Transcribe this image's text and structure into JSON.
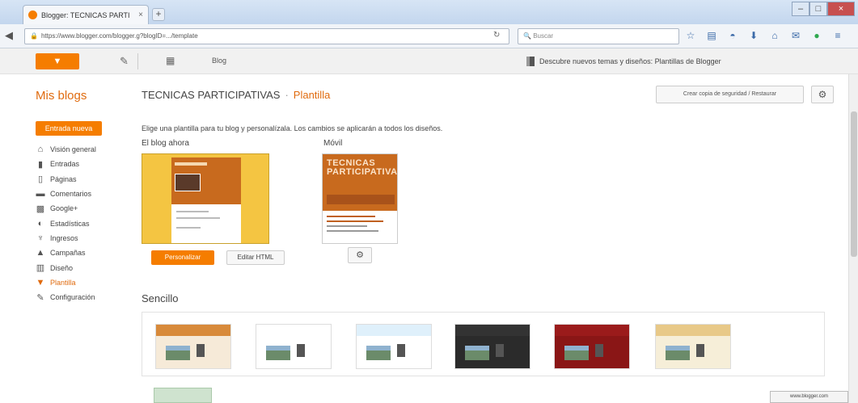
{
  "browser": {
    "tab_title": "Blogger: TECNICAS PARTI",
    "tab_close": "×",
    "new_tab": "+",
    "url": "https://www.blogger.com/blogger.g?blogID=.../template",
    "search_placeholder": "Buscar",
    "window_controls": [
      "–",
      "□",
      "×"
    ]
  },
  "blogger_bar": {
    "post_title": "Blog",
    "notice": "Descubre nuevos temas y diseños: Plantillas de Blogger"
  },
  "sidebar": {
    "title": "Mis blogs",
    "new_entry": "Entrada nueva",
    "items": [
      {
        "label": "Visión general",
        "icon": "home-icon"
      },
      {
        "label": "Entradas",
        "icon": "document-icon"
      },
      {
        "label": "Páginas",
        "icon": "page-icon"
      },
      {
        "label": "Comentarios",
        "icon": "comment-icon"
      },
      {
        "label": "Google+",
        "icon": "googleplus-icon"
      },
      {
        "label": "Estadísticas",
        "icon": "stats-icon"
      },
      {
        "label": "Ingresos",
        "icon": "trophy-icon"
      },
      {
        "label": "Campañas",
        "icon": "campaign-icon"
      },
      {
        "label": "Diseño",
        "icon": "layout-icon"
      },
      {
        "label": "Plantilla",
        "icon": "template-icon",
        "active": true
      },
      {
        "label": "Configuración",
        "icon": "wrench-icon"
      }
    ]
  },
  "main": {
    "blog_name": "TECNICAS PARTICIPATIVAS",
    "separator": "·",
    "breadcrumb": "Plantilla",
    "backup_button": "Crear copia de seguridad / Restaurar",
    "intro": "Elige una plantilla para tu blog y personalízala. Los cambios se aplicarán a todos los diseños.",
    "live_label": "El blog ahora",
    "mobile_label": "Móvil",
    "mobile_preview_title": "TECNICAS PARTICIPATIVAS",
    "customize_button": "Personalizar",
    "edit_html_button": "Editar HTML",
    "section_title": "Sencillo",
    "status_text": "www.blogger.com"
  },
  "colors": {
    "accent": "#f57d00",
    "accent_text": "#e06b0f",
    "live_theme_bg": "#f4c542",
    "theme_header": "#c86a1e"
  },
  "templates": [
    {
      "header": "#d88a3a",
      "bg": "#f6ead8"
    },
    {
      "header": "#ffffff",
      "bg": "#ffffff"
    },
    {
      "header": "#dff0fb",
      "bg": "#ffffff"
    },
    {
      "header": "#333333",
      "bg": "#2b2b2b"
    },
    {
      "header": "#9b1b1b",
      "bg": "#8a1616"
    },
    {
      "header": "#e8c988",
      "bg": "#f6eed8"
    }
  ]
}
